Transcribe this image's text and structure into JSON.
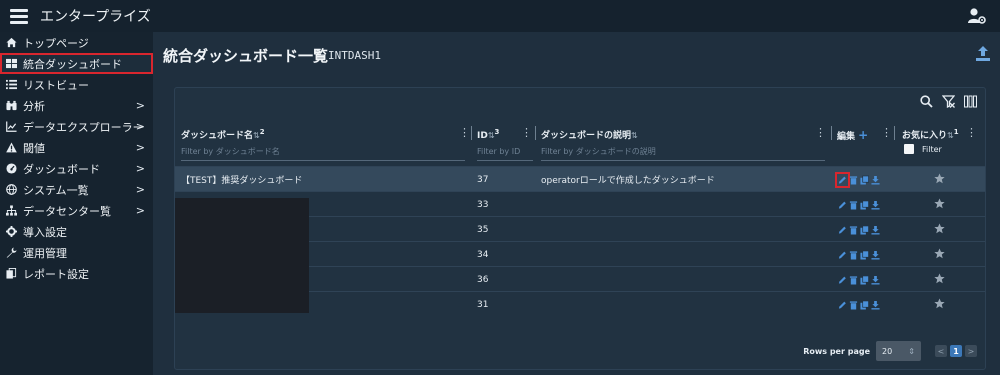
{
  "app": {
    "title": "エンタープライズ"
  },
  "sidebar": {
    "items": [
      {
        "label": "トップページ",
        "icon": "home-icon",
        "chevron": false
      },
      {
        "label": "統合ダッシュボード",
        "icon": "dashboard-grid-icon",
        "chevron": false,
        "active": true
      },
      {
        "label": "リストビュー",
        "icon": "list-icon",
        "chevron": false
      },
      {
        "label": "分析",
        "icon": "binoculars-icon",
        "chevron": true
      },
      {
        "label": "データエクスプローラー",
        "icon": "line-chart-icon",
        "chevron": true
      },
      {
        "label": "閾値",
        "icon": "warning-icon",
        "chevron": true
      },
      {
        "label": "ダッシュボード",
        "icon": "gauge-icon",
        "chevron": true
      },
      {
        "label": "システム一覧",
        "icon": "globe-icon",
        "chevron": true
      },
      {
        "label": "データセンター覧",
        "icon": "sitemap-icon",
        "chevron": true
      },
      {
        "label": "導入設定",
        "icon": "gear-icon",
        "chevron": false
      },
      {
        "label": "運用管理",
        "icon": "wrench-icon",
        "chevron": false
      },
      {
        "label": "レポート設定",
        "icon": "copy-icon",
        "chevron": false
      }
    ],
    "chevron_glyph": ">"
  },
  "page": {
    "title": "統合ダッシュボード一覧",
    "code": "INTDASH1"
  },
  "table": {
    "columns": {
      "name": {
        "label": "ダッシュボード名",
        "sort": "⇅",
        "sort_order": "2",
        "filter_placeholder": "Filter by ダッシュボード名"
      },
      "id": {
        "label": "ID",
        "sort": "⇅",
        "sort_order": "3",
        "filter_placeholder": "Filter by ID"
      },
      "description": {
        "label": "ダッシュボードの説明",
        "sort": "⇅",
        "filter_placeholder": "Filter by ダッシュボードの説明"
      },
      "edit": {
        "label": "編集",
        "add_glyph": "+"
      },
      "favorite": {
        "label": "お気に入り",
        "sort": "⇅",
        "sort_order": "1",
        "filter_label": "Filter"
      }
    },
    "rows": [
      {
        "name": "【TEST】推奨ダッシュボード",
        "id": "37",
        "description": "operatorロールで作成したダッシュボード",
        "highlight": true
      },
      {
        "name": "",
        "id": "33",
        "description": ""
      },
      {
        "name": "",
        "id": "35",
        "description": ""
      },
      {
        "name": "",
        "id": "34",
        "description": ""
      },
      {
        "name": "",
        "id": "36",
        "description": ""
      },
      {
        "name": "",
        "id": "31",
        "description": ""
      }
    ],
    "menu_glyph": "⋮"
  },
  "pagination": {
    "rows_per_page_label": "Rows per page",
    "rows_per_page_value": "20",
    "select_arrows": "⇕",
    "prev": "<",
    "current_page": "1",
    "next": ">"
  },
  "colors": {
    "accent": "#4a90d9",
    "highlight_box": "#d9262e",
    "star": "#9aa8b5"
  }
}
